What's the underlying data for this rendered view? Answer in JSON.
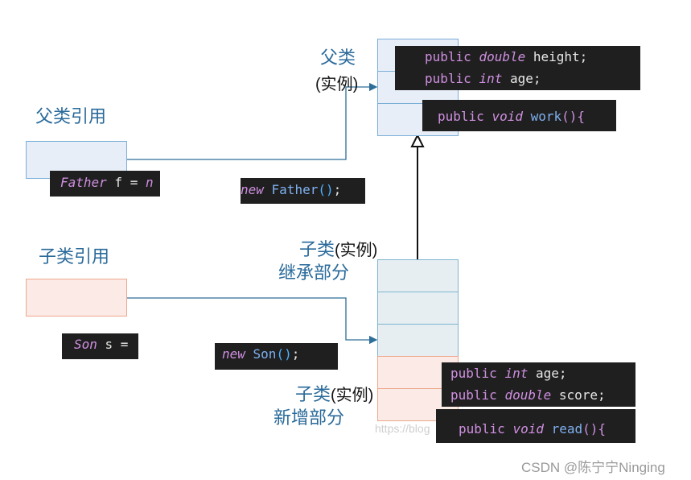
{
  "father_section": {
    "reference_label": "父类引用",
    "instance_label_cn": "父类",
    "instance_label_paren": "(实例)",
    "decl_code": {
      "type": "Father",
      "var": " f = ",
      "cut": "n"
    },
    "new_code": {
      "kw": "new",
      "cls": " Father",
      "paren": "()",
      "semi": ";"
    },
    "fields": [
      {
        "mod": "public ",
        "type": "double",
        "name": " height;"
      },
      {
        "mod": "public ",
        "type": "int",
        "name": " age;"
      }
    ],
    "method": {
      "mod": "public ",
      "type": "void",
      "name": " work",
      "paren": "()",
      "brace": "{"
    }
  },
  "son_section": {
    "reference_label": "子类引用",
    "inherited_label_cn": "子类",
    "inherited_label_paren": "(实例)",
    "inherited_sub": "继承部分",
    "new_label_cn": "子类",
    "new_label_paren": "(实例)",
    "new_sub": "新增部分",
    "decl_code": {
      "type": "Son",
      "var": " s ="
    },
    "new_code": {
      "kw": "new",
      "cls": " Son",
      "paren": "()",
      "semi": ";"
    },
    "fields": [
      {
        "mod": "public ",
        "type": "int",
        "name": " age;"
      },
      {
        "mod": "public ",
        "type": "double",
        "name": " score;"
      }
    ],
    "method": {
      "mod": "public ",
      "type": "void",
      "name": " read",
      "paren": "()",
      "brace": "{"
    }
  },
  "watermark": {
    "url_fragment": "https://blog",
    "credit": "CSDN @陈宁宁Ninging"
  },
  "colors": {
    "label_blue": "#2a6a9a",
    "connector": "#2e6e99",
    "father_fill": "#e8eef8",
    "son_inherited_fill": "#e6eef2",
    "son_new_fill": "#fbeae5",
    "code_bg": "#1f1f1f"
  }
}
